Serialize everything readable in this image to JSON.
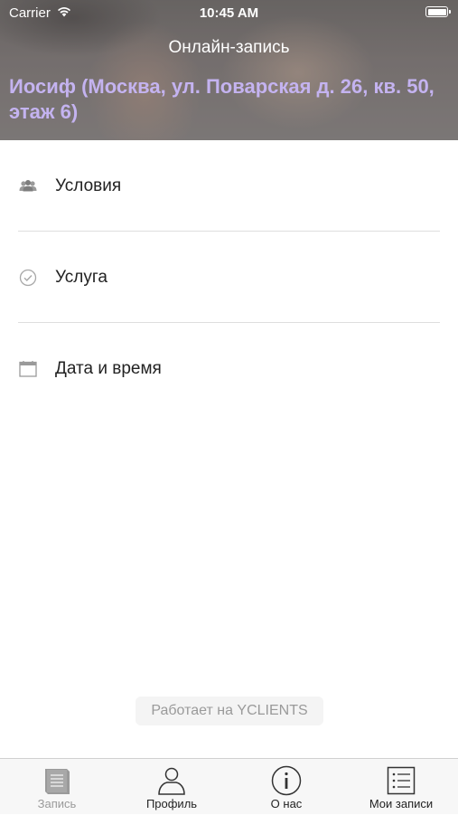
{
  "status_bar": {
    "carrier": "Carrier",
    "time": "10:45 AM"
  },
  "header": {
    "title": "Онлайн-запись",
    "salon": "Иосиф (Москва, ул. Поварская д. 26, кв. 50, этаж 6)"
  },
  "menu": {
    "items": [
      {
        "label": "Условия",
        "icon": "people-icon"
      },
      {
        "label": "Услуга",
        "icon": "check-circle-icon"
      },
      {
        "label": "Дата и время",
        "icon": "calendar-icon"
      }
    ]
  },
  "footer": {
    "powered_by": "Работает на YCLIENTS"
  },
  "tabbar": {
    "tabs": [
      {
        "label": "Запись",
        "icon": "book-icon",
        "active": true
      },
      {
        "label": "Профиль",
        "icon": "person-icon",
        "active": false
      },
      {
        "label": "О нас",
        "icon": "info-icon",
        "active": false
      },
      {
        "label": "Мои записи",
        "icon": "list-icon",
        "active": false
      }
    ]
  },
  "colors": {
    "accent_text": "#c4b3f0",
    "active_tab": "#9a9a9a",
    "divider": "#dedede"
  }
}
